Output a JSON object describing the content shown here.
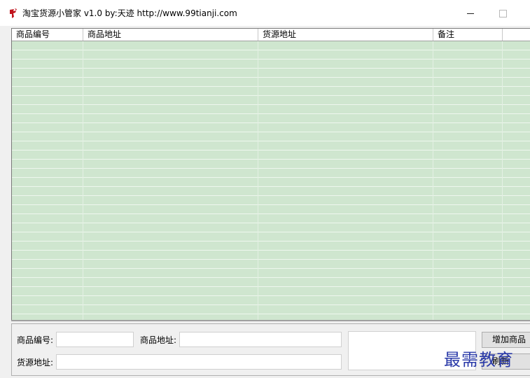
{
  "window": {
    "title": "淘宝货源小管家 v1.0  by:天迹 http://www.99tianji.com",
    "icon": "app-logo-icon",
    "minimize_icon": "minimize-icon",
    "maximize_icon": "maximize-icon"
  },
  "list": {
    "columns": [
      "商品编号",
      "商品地址",
      "货源地址",
      "备注"
    ],
    "rows": [],
    "row_color": "#cfe6cf"
  },
  "form": {
    "product_id_label": "商品编号:",
    "product_id_value": "",
    "product_url_label": "商品地址:",
    "product_url_value": "",
    "source_url_label": "货源地址:",
    "source_url_value": "",
    "note_value": ""
  },
  "buttons": {
    "add_label": "增加商品",
    "second_label": "刷新"
  },
  "watermark": "最需教育"
}
